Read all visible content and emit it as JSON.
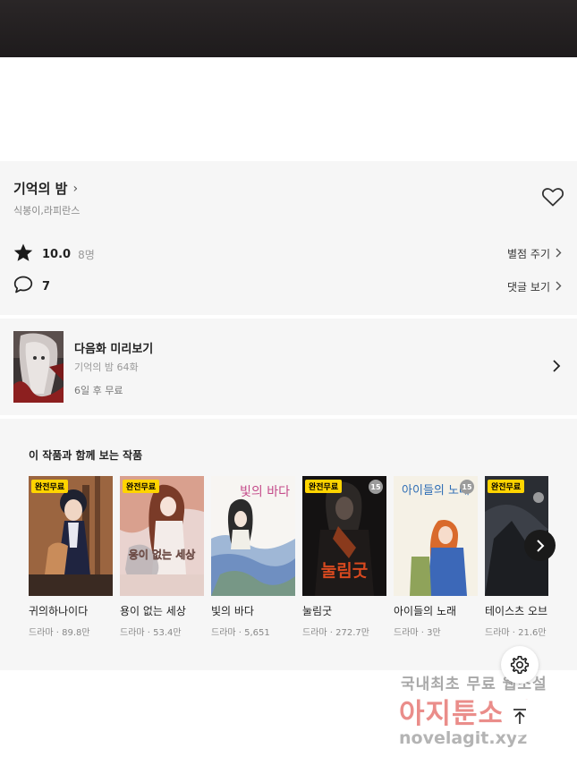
{
  "work": {
    "title": "기억의 밤",
    "authors": "식봉이,라피란스",
    "rating": "10.0",
    "rating_count": "8명",
    "rate_link": "별점 주기",
    "comment_count": "7",
    "comment_link": "댓글 보기"
  },
  "next_episode": {
    "label": "다음화 미리보기",
    "episode": "기억의 밤 64화",
    "free_info": "6일 후 무료"
  },
  "recommendations": {
    "title": "이 작품과 함께 보는 작품",
    "items": [
      {
        "name": "귀의하나이다",
        "meta": "드라마 · 89.8만",
        "badge": "완전무료",
        "age": ""
      },
      {
        "name": "용이 없는 세상",
        "meta": "드라마 · 53.4만",
        "badge": "완전무료",
        "age": ""
      },
      {
        "name": "빛의 바다",
        "meta": "드라마 · 5,651",
        "badge": "",
        "age": ""
      },
      {
        "name": "눌림굿",
        "meta": "드라마 · 272.7만",
        "badge": "완전무료",
        "age": "15"
      },
      {
        "name": "아이들의 노래",
        "meta": "드라마 · 3만",
        "badge": "",
        "age": "15"
      },
      {
        "name": "테이스츠 오브 러",
        "meta": "드라마 · 21.6만",
        "badge": "완전무료",
        "age": ""
      }
    ],
    "cover_texts": {
      "c2": "용이 없는 세상",
      "c3": "빛의 바다",
      "c4": "눌림굿",
      "c5": "아이들의 노래"
    }
  },
  "watermark": {
    "line1": "국내최초 무료 웹소설",
    "line2": "아지툰소설",
    "line3": "novelagit.xyz"
  },
  "icons": {
    "heart": "heart-outline-icon",
    "star": "star-icon",
    "comment": "speech-bubble-icon",
    "chevron": "chevron-right-icon",
    "settings": "gear-icon",
    "top": "arrow-up-icon"
  },
  "colors": {
    "free_badge": "#ffd400",
    "panel_bg": "#f6f6f6",
    "banner": "#231f20"
  }
}
